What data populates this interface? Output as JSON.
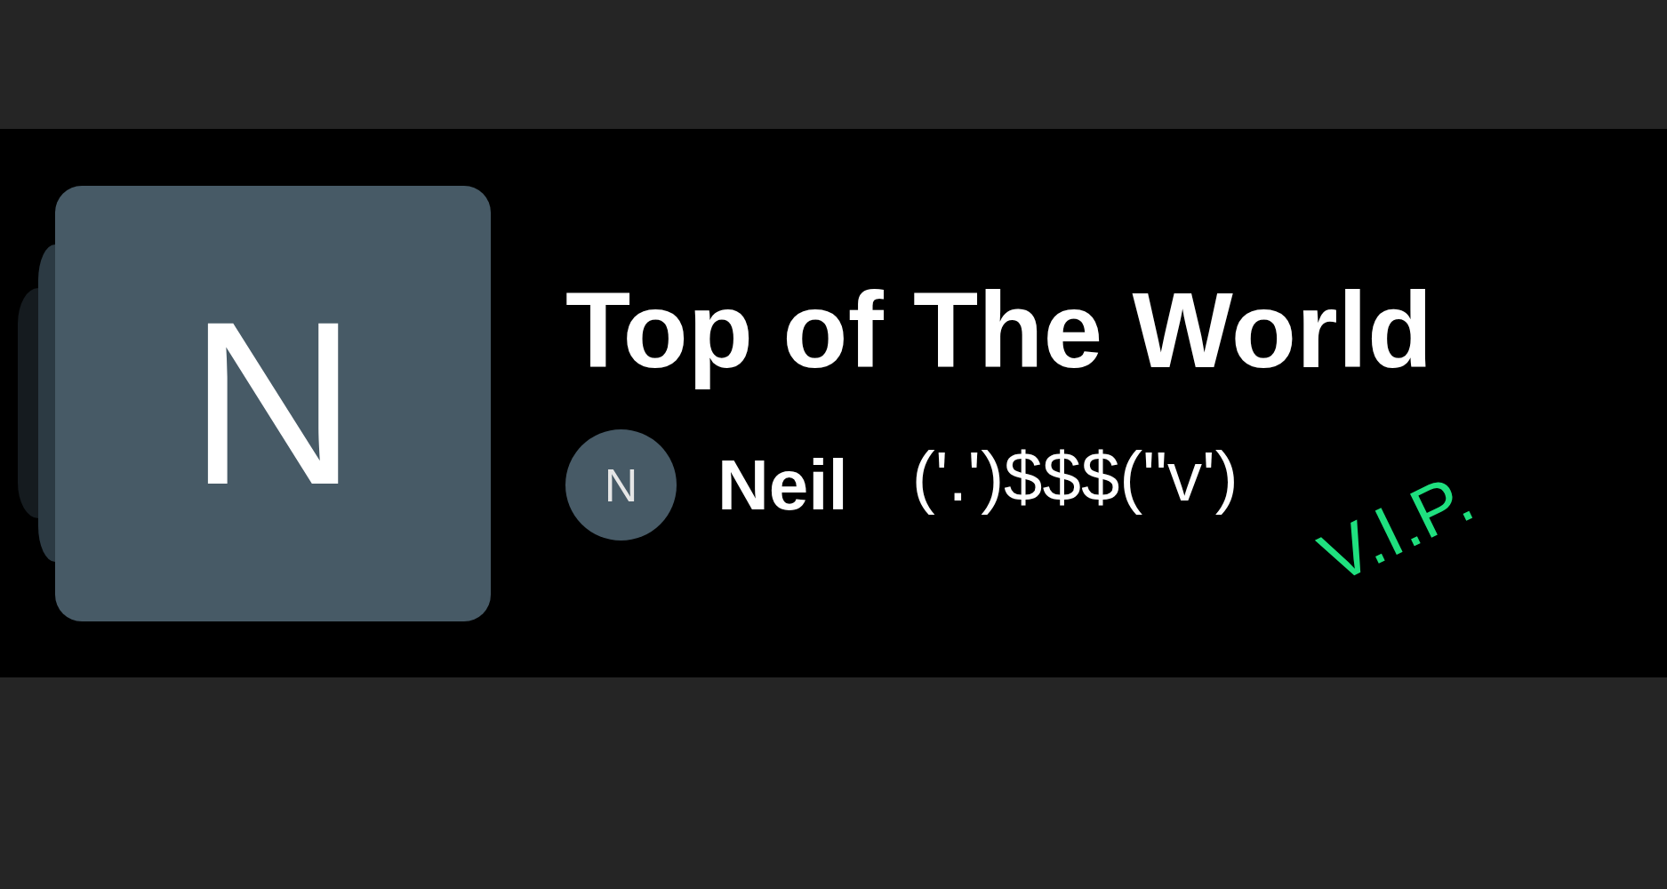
{
  "card": {
    "cover": {
      "initial": "N"
    },
    "title": "Top of The World",
    "author": {
      "initial": "N",
      "name": "Neil"
    },
    "tagline": "('.')$$$(\"v')",
    "badge": "V.I.P."
  }
}
